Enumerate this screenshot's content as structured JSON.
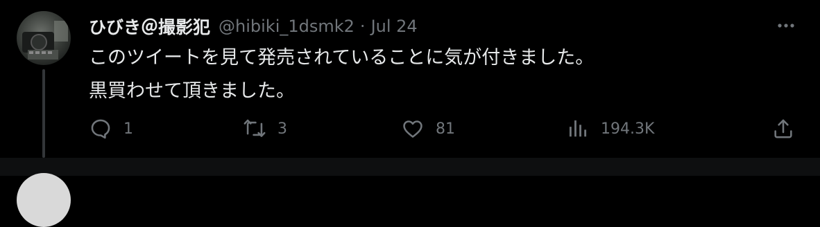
{
  "tweet": {
    "display_name": "ひびき＠撮影犯",
    "handle": "@hibiki_1dsmk2",
    "separator": "·",
    "date": "Jul 24",
    "text_lines": [
      "このツイートを見て発売されていることに気が付きました。",
      "黒買わせて頂きました。"
    ],
    "actions": {
      "reply_count": "1",
      "retweet_count": "3",
      "like_count": "81",
      "views_count": "194.3K"
    }
  },
  "icons": {
    "more": "more-horizontal-icon",
    "reply": "reply-bubble-icon",
    "retweet": "retweet-arrows-icon",
    "like": "heart-icon",
    "views": "bar-chart-icon",
    "share": "share-upload-icon"
  },
  "colors": {
    "background": "#000000",
    "primary_text": "#e7e9ea",
    "secondary_text": "#71767b",
    "thread_line": "#333639"
  }
}
